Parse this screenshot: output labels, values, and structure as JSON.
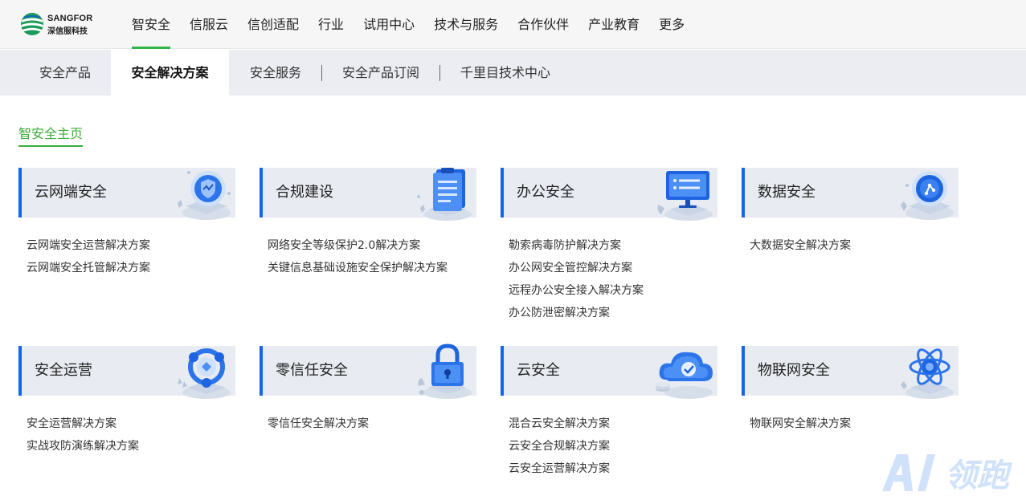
{
  "header": {
    "brand_en": "SANGFOR",
    "brand_cn": "深信服科技",
    "nav": [
      {
        "label": "智安全",
        "active": true
      },
      {
        "label": "信服云"
      },
      {
        "label": "信创适配"
      },
      {
        "label": "行业"
      },
      {
        "label": "试用中心"
      },
      {
        "label": "技术与服务"
      },
      {
        "label": "合作伙伴"
      },
      {
        "label": "产业教育"
      },
      {
        "label": "更多"
      }
    ]
  },
  "subnav": {
    "items": [
      {
        "label": "安全产品"
      },
      {
        "label": "安全解决方案",
        "active": true
      },
      {
        "label": "安全服务"
      },
      {
        "label": "安全产品订阅"
      },
      {
        "label": "千里目技术中心"
      }
    ]
  },
  "home_link": "智安全主页",
  "cards": [
    {
      "title": "云网端安全",
      "icon": "shield-icon",
      "links": [
        "云网端安全运营解决方案",
        "云网端安全托管解决方案"
      ]
    },
    {
      "title": "合规建设",
      "icon": "clipboard-icon",
      "links": [
        "网络安全等级保护2.0解决方案",
        "关键信息基础设施安全保护解决方案"
      ]
    },
    {
      "title": "办公安全",
      "icon": "monitor-icon",
      "links": [
        "勒索病毒防护解决方案",
        "办公网安全管控解决方案",
        "远程办公安全接入解决方案",
        "办公防泄密解决方案"
      ]
    },
    {
      "title": "数据安全",
      "icon": "data-network-icon",
      "links": [
        "大数据安全解决方案"
      ]
    },
    {
      "title": "安全运营",
      "icon": "ops-cycle-icon",
      "links": [
        "安全运营解决方案",
        "实战攻防演练解决方案"
      ]
    },
    {
      "title": "零信任安全",
      "icon": "lock-icon",
      "links": [
        "零信任安全解决方案"
      ]
    },
    {
      "title": "云安全",
      "icon": "cloud-check-icon",
      "links": [
        "混合云安全解决方案",
        "云安全合规解决方案",
        "云安全运营解决方案"
      ]
    },
    {
      "title": "物联网安全",
      "icon": "atom-icon",
      "links": [
        "物联网安全解决方案"
      ]
    }
  ],
  "watermark": "AI领跑",
  "colors": {
    "accent_green": "#2fb54a",
    "card_blue": "#1366e6",
    "card_bg": "#e8ebf1",
    "subnav_bg": "#ebedf2"
  }
}
